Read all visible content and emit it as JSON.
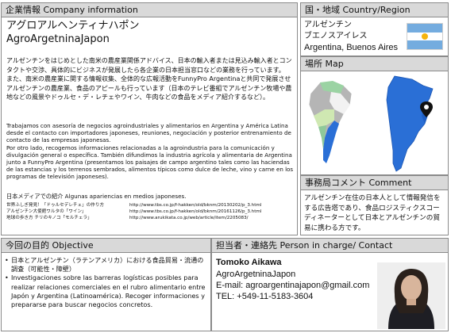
{
  "company": {
    "header": "企業情報 Company information",
    "name_jp": "アグロアルヘンティナハポン",
    "name_en": "AgroArgetninaJapon",
    "desc_jp": "アルゼンチンをはじめとした南米の農産業関係アドバイス、日本の輸入者または見込み輸入者とコンタクトや交渉、具体的にビジネスが発展したら各企業の日本担当窓口などの業務を行っています。\nまた、南米の農産業に関する情報収集、全体的な広報活動をFunnyPro Argentinaと共同で発展させアルゼンチンの農産業、食品のアピールも行っています（日本のテレビ番組でアルゼンチン牧場や農地などの風景やドゥルセ・デ・レチェやワイン、牛肉などの食品をメディア紹介するなど）。",
    "desc_es": "Trabajamos con asesoría de negocios agroindustriales y alimentarios en Argentina y América Latina desde el contacto con importadores japoneses, reuniones, negociación y posterior entrenamiento de contacto de las empresas japonesas.\nPor otro lado, recogemos informaciones relacionadas a la agroindustria para la comunicación y divulgación general o específica. También difundimos la industria agrícola y alimentaria de Argentina junto a FunnyPro Argentina (presentamos los paisajes de campo argentino tales como las haciendas de las estancias y los terrenos sembrados, alimentos típicos como dulce de leche, vino y carne en los programas de televisión japoneses).",
    "media_title": "日本メディアでの紹介 Algunas apariencias en medios japoneses.",
    "media": [
      {
        "title": "世界ふしぎ発見！「ドゥルセデレチェ」の作り方",
        "url": "http://www.tbs.co.jp/f-hakken/old/bknm/20130202/p_3.html"
      },
      {
        "title": "アルゼンチン大使館ワルタの「ワイン」",
        "url": "http://www.tbs.co.jp/f-hakken/old/bknm/20161126/p_3.html"
      },
      {
        "title": "地球の歩き方  チリのキノコ「モルチェラ」",
        "url": "http://www.arukikata.co.jp/web/article/item/2205083/"
      }
    ]
  },
  "country": {
    "header": "国・地域 Country/Region",
    "line1": "アルゼンチン",
    "line2": "ブエノスアイレス",
    "line3": "Argentina, Buenos Aires"
  },
  "map": {
    "header": "場所 Map"
  },
  "comment": {
    "header": "事務局コメント Comment",
    "text": "アルゼンチン在住の日本人として情報発信をする広告塔であり、食品ロジスティクスコーディネーターとして日本とアルゼンチンの貿易に携わる方です。"
  },
  "objective": {
    "header": "今回の目的 Objective",
    "items": [
      "日本とアルゼンチン（ラテンアメリカ）における食品貿易・流通の調査（可能性・障壁）",
      "Investigaciones sobre las barreras logísticas posibles para realizar relaciones comerciales en el rubro alimentario entre Japón y Argentina (Latinoamérica). Recoger informaciones y prepararse para buscar negocios concretos."
    ]
  },
  "contact": {
    "header": "担当者・連絡先 Person in charge/ Contact",
    "name": "Tomoko Aikawa",
    "company": "AgroArgetninaJapon",
    "email": "E-mail: agroargentinajapon@gmail.com",
    "tel": "TEL: +549-11-5183-3604"
  },
  "colors": {
    "header_bg": "#d9d9d9",
    "border": "#8a8a8a",
    "flag_blue": "#74acdf",
    "flag_sun": "#f6b40e",
    "map_highlight": "#2a6fd6",
    "map_land": "#8fc99a"
  }
}
